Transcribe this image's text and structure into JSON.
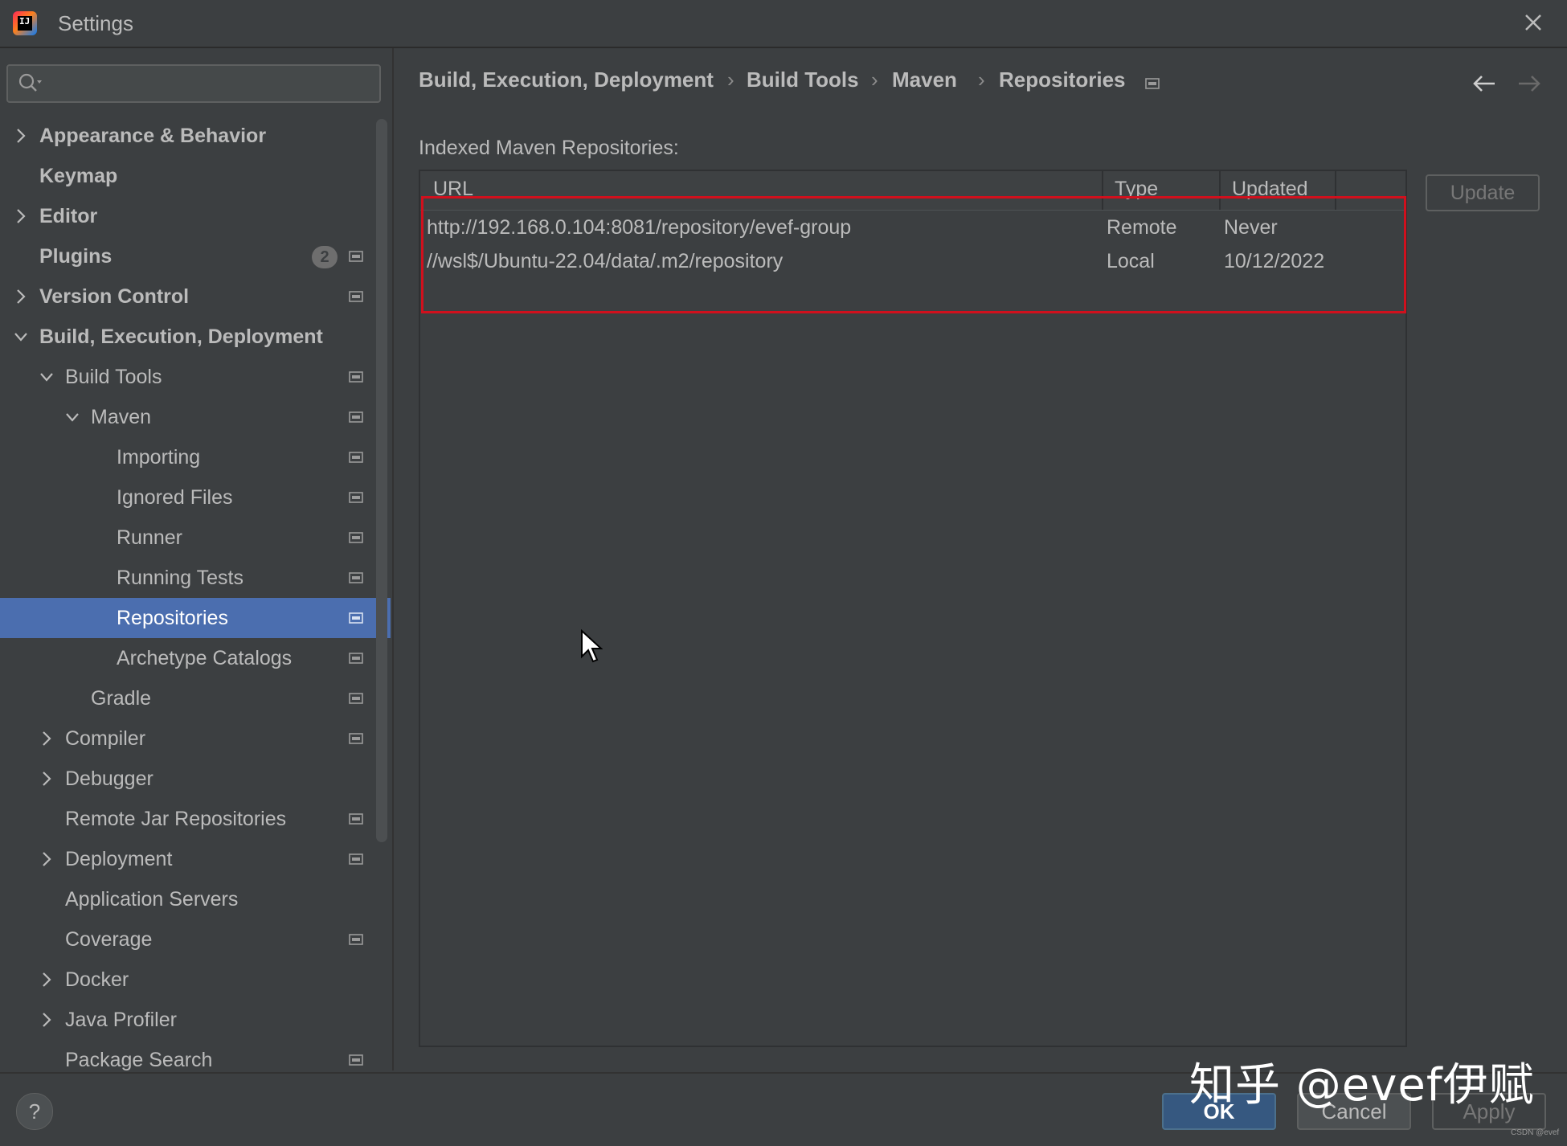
{
  "window": {
    "title": "Settings",
    "logo_text": "IJ"
  },
  "search": {
    "value": "",
    "placeholder": ""
  },
  "sidebar": {
    "items": [
      {
        "label": "Appearance & Behavior",
        "bold": true,
        "expander": "collapsed",
        "indent": 0
      },
      {
        "label": "Keymap",
        "bold": true,
        "expander": "none",
        "indent": 0
      },
      {
        "label": "Editor",
        "bold": true,
        "expander": "collapsed",
        "indent": 0
      },
      {
        "label": "Plugins",
        "bold": true,
        "expander": "none",
        "indent": 0,
        "badge": "2",
        "project_icon": true
      },
      {
        "label": "Version Control",
        "bold": true,
        "expander": "collapsed",
        "indent": 0,
        "project_icon": true
      },
      {
        "label": "Build, Execution, Deployment",
        "bold": true,
        "expander": "expanded",
        "indent": 0
      },
      {
        "label": "Build Tools",
        "expander": "expanded",
        "indent": 1,
        "project_icon": true
      },
      {
        "label": "Maven",
        "expander": "expanded",
        "indent": 2,
        "project_icon": true
      },
      {
        "label": "Importing",
        "expander": "none",
        "indent": 3,
        "project_icon": true
      },
      {
        "label": "Ignored Files",
        "expander": "none",
        "indent": 3,
        "project_icon": true
      },
      {
        "label": "Runner",
        "expander": "none",
        "indent": 3,
        "project_icon": true
      },
      {
        "label": "Running Tests",
        "expander": "none",
        "indent": 3,
        "project_icon": true
      },
      {
        "label": "Repositories",
        "expander": "none",
        "indent": 3,
        "project_icon": true,
        "selected": true
      },
      {
        "label": "Archetype Catalogs",
        "expander": "none",
        "indent": 3,
        "project_icon": true
      },
      {
        "label": "Gradle",
        "expander": "none",
        "indent": 2,
        "project_icon": true
      },
      {
        "label": "Compiler",
        "expander": "collapsed",
        "indent": 1,
        "project_icon": true
      },
      {
        "label": "Debugger",
        "expander": "collapsed",
        "indent": 1
      },
      {
        "label": "Remote Jar Repositories",
        "expander": "none",
        "indent": 1,
        "project_icon": true
      },
      {
        "label": "Deployment",
        "expander": "collapsed",
        "indent": 1,
        "project_icon": true
      },
      {
        "label": "Application Servers",
        "expander": "none",
        "indent": 1
      },
      {
        "label": "Coverage",
        "expander": "none",
        "indent": 1,
        "project_icon": true
      },
      {
        "label": "Docker",
        "expander": "collapsed",
        "indent": 1
      },
      {
        "label": "Java Profiler",
        "expander": "collapsed",
        "indent": 1
      },
      {
        "label": "Package Search",
        "expander": "none",
        "indent": 1,
        "project_icon": true
      }
    ]
  },
  "breadcrumb": {
    "items": [
      "Build, Execution, Deployment",
      "Build Tools",
      "Maven",
      "Repositories"
    ],
    "separator": "›"
  },
  "main": {
    "section_label": "Indexed Maven Repositories:",
    "table": {
      "columns": [
        "URL",
        "Type",
        "Updated"
      ],
      "rows": [
        [
          "http://192.168.0.104:8081/repository/evef-group",
          "Remote",
          "Never"
        ],
        [
          "//wsl$/Ubuntu-22.04/data/.m2/repository",
          "Local",
          "10/12/2022"
        ]
      ]
    },
    "update_label": "Update"
  },
  "footer": {
    "help_label": "?",
    "ok_label": "OK",
    "cancel_label": "Cancel",
    "apply_label": "Apply"
  },
  "watermark": {
    "text": "知乎 @evef伊赋",
    "small_text": "CSDN @evef"
  },
  "colors": {
    "background": "#3c3f41",
    "selection": "#4b6eaf",
    "highlight_box": "#d0101d",
    "ok_button": "#365880",
    "text": "#bbbbbb"
  }
}
